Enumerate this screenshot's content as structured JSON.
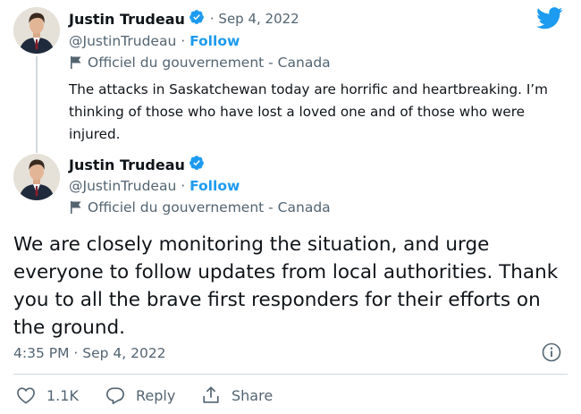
{
  "tweets": [
    {
      "author_name": "Justin Trudeau",
      "date": "· Sep 4, 2022",
      "handle": "@JustinTrudeau",
      "separator": "·",
      "follow_label": "Follow",
      "gov_label": "Officiel du gouvernement - Canada",
      "text": "The attacks in Saskatchewan today are horrific and heartbreaking. I’m thinking of those who have lost a loved one and of those who were injured."
    },
    {
      "author_name": "Justin Trudeau",
      "handle": "@JustinTrudeau",
      "separator": "·",
      "follow_label": "Follow",
      "gov_label": "Officiel du gouvernement - Canada",
      "text": "We are closely monitoring the situation, and urge everyone to follow updates from local authorities. Thank you to all the brave first responders for their efforts on the ground."
    }
  ],
  "timestamp": "4:35 PM · Sep 4, 2022",
  "actions": {
    "like_count": "1.1K",
    "reply_label": "Reply",
    "share_label": "Share"
  },
  "icons": {
    "brand": "twitter-bird-icon",
    "verified": "verified-badge-icon",
    "label": "flag-icon",
    "info": "info-icon",
    "like": "heart-icon",
    "reply": "reply-icon",
    "share": "share-icon"
  },
  "colors": {
    "brand_blue": "#1d9bf0",
    "text": "#0f1419",
    "secondary": "#536471",
    "divider": "#cfd9de"
  }
}
